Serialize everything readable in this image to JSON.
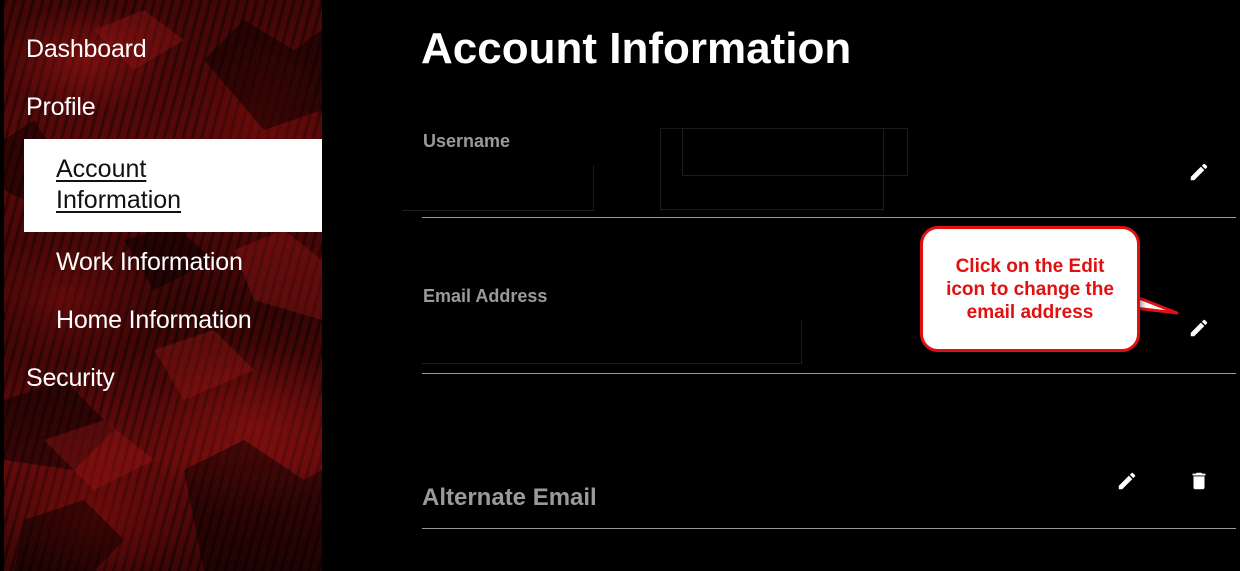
{
  "sidebar": {
    "items": [
      {
        "label": "Dashboard"
      },
      {
        "label": "Profile"
      },
      {
        "label": "Account Information",
        "active": true
      },
      {
        "label": "Work Information"
      },
      {
        "label": "Home Information"
      },
      {
        "label": "Security"
      }
    ]
  },
  "main": {
    "title": "Account Information",
    "fields": {
      "username": {
        "label": "Username",
        "value": "",
        "edit_icon": "pencil-icon"
      },
      "email": {
        "label": "Email Address",
        "value": "",
        "edit_icon": "pencil-icon"
      },
      "alternate_email": {
        "label": "Alternate Email",
        "edit_icon": "pencil-icon",
        "delete_icon": "trash-icon"
      }
    }
  },
  "callout": {
    "text": "Click on the Edit icon to change the email address",
    "border_color": "#e01010",
    "text_color": "#e01010"
  },
  "colors": {
    "background": "#000000",
    "text_primary": "#ffffff",
    "text_muted": "#9a9a9a",
    "sidebar_accent": "#5a0a0a",
    "active_item_bg": "#ffffff"
  }
}
